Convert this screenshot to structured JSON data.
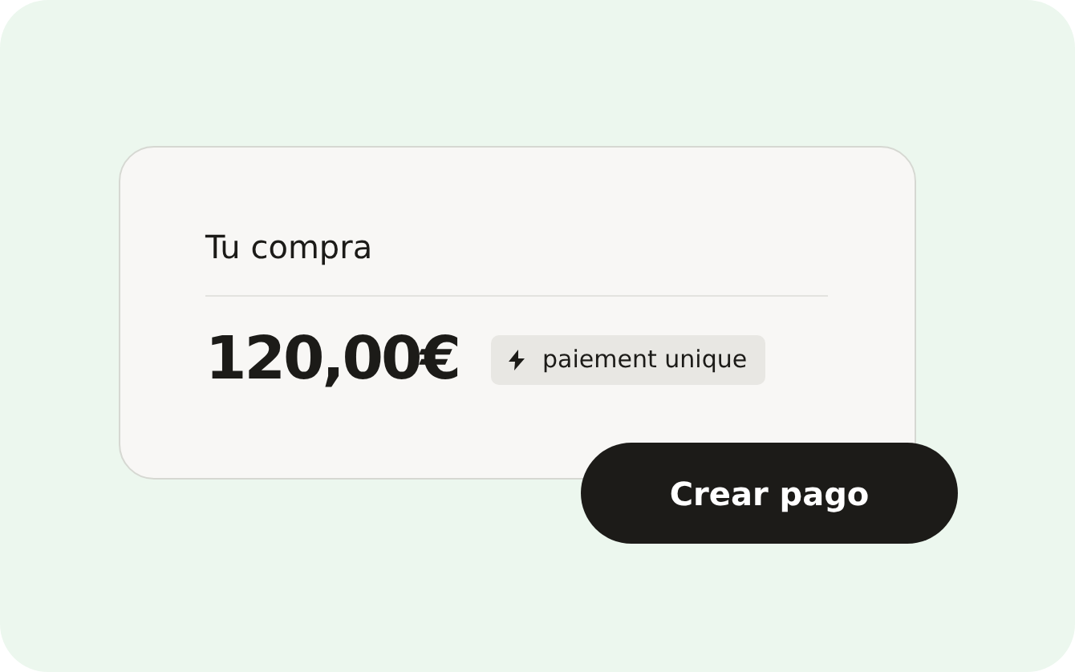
{
  "card": {
    "title": "Tu compra",
    "price": "120,00€",
    "badge": {
      "label": "paiement unique"
    }
  },
  "button": {
    "label": "Crear pago"
  }
}
